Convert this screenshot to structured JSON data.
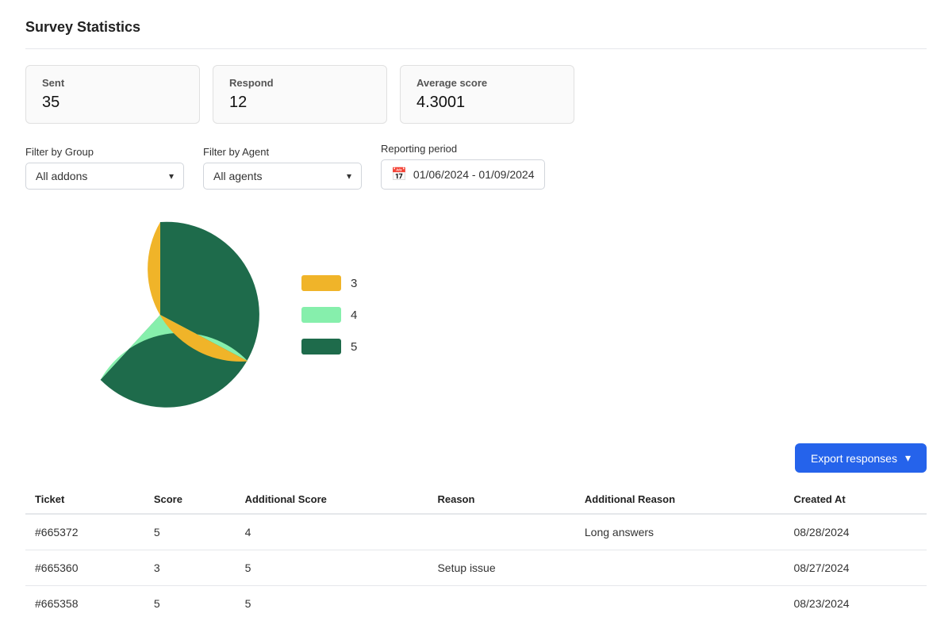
{
  "page": {
    "title": "Survey Statistics"
  },
  "stats": {
    "sent_label": "Sent",
    "sent_value": "35",
    "respond_label": "Respond",
    "respond_value": "12",
    "avg_score_label": "Average score",
    "avg_score_value": "4.3001"
  },
  "filters": {
    "group_label": "Filter by Group",
    "group_value": "All addons",
    "agent_label": "Filter by Agent",
    "agent_value": "All agents",
    "period_label": "Reporting period",
    "period_value": "01/06/2024 - 01/09/2024"
  },
  "chart": {
    "legend": [
      {
        "label": "3",
        "color": "#f0b429"
      },
      {
        "label": "4",
        "color": "#86efac"
      },
      {
        "label": "5",
        "color": "#1e6b4b"
      }
    ]
  },
  "export_button": "Export responses",
  "table": {
    "columns": [
      "Ticket",
      "Score",
      "Additional Score",
      "Reason",
      "Additional Reason",
      "Created At"
    ],
    "rows": [
      {
        "ticket": "#665372",
        "score": "5",
        "additional_score": "4",
        "reason": "",
        "additional_reason": "Long answers",
        "created_at": "08/28/2024"
      },
      {
        "ticket": "#665360",
        "score": "3",
        "additional_score": "5",
        "reason": "Setup issue",
        "additional_reason": "",
        "created_at": "08/27/2024"
      },
      {
        "ticket": "#665358",
        "score": "5",
        "additional_score": "5",
        "reason": "",
        "additional_reason": "",
        "created_at": "08/23/2024"
      }
    ]
  }
}
